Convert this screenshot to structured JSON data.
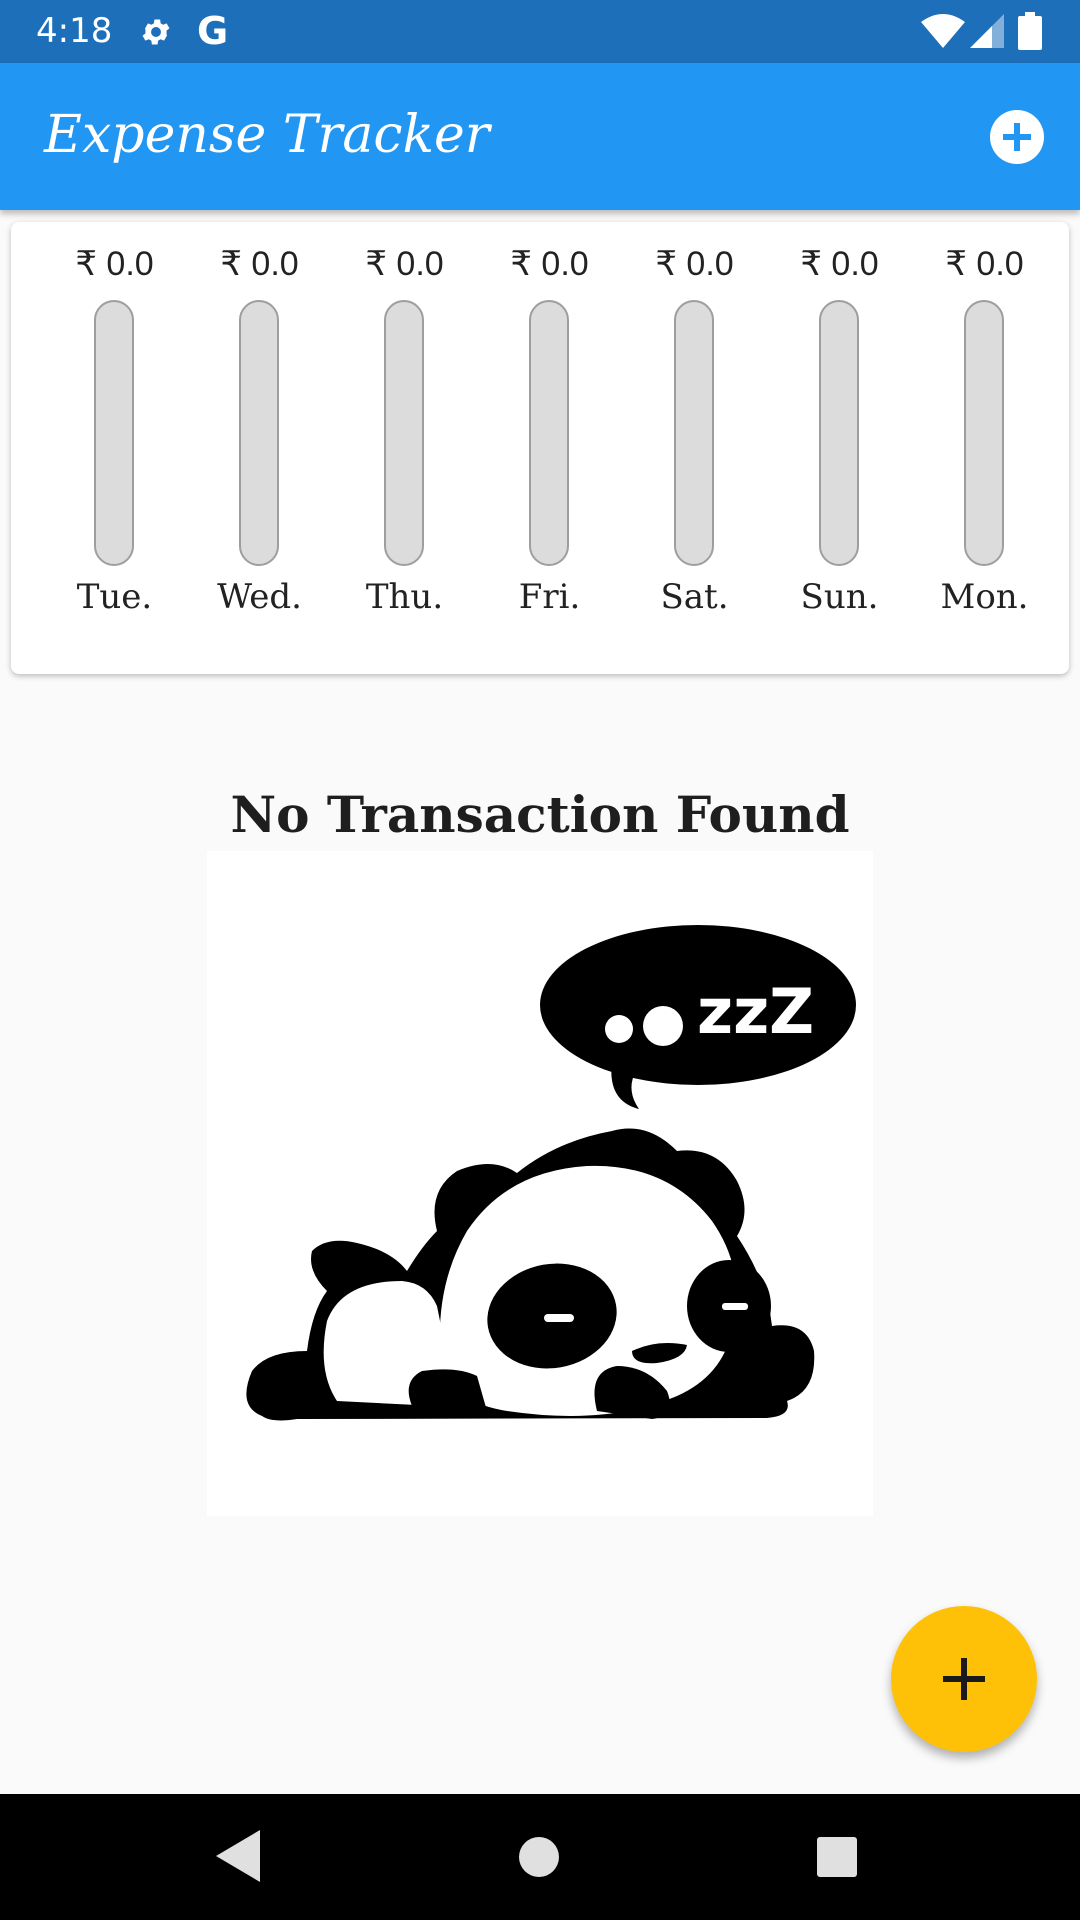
{
  "status_bar": {
    "time": "4:18",
    "left_icons": [
      "gear-icon",
      "google-g-icon"
    ],
    "g_glyph": "G",
    "right_icons": [
      "wifi-icon",
      "signal-icon",
      "battery-icon"
    ]
  },
  "app_bar": {
    "title": "Expense Tracker",
    "action_icon": "add-circle-icon",
    "color": "#2196f3"
  },
  "chart": {
    "bars": [
      {
        "amount": "₹ 0.0",
        "day": "Tue.",
        "fill_fraction": 0
      },
      {
        "amount": "₹ 0.0",
        "day": "Wed.",
        "fill_fraction": 0
      },
      {
        "amount": "₹ 0.0",
        "day": "Thu.",
        "fill_fraction": 0
      },
      {
        "amount": "₹ 0.0",
        "day": "Fri.",
        "fill_fraction": 0
      },
      {
        "amount": "₹ 0.0",
        "day": "Sat.",
        "fill_fraction": 0
      },
      {
        "amount": "₹ 0.0",
        "day": "Sun.",
        "fill_fraction": 0
      },
      {
        "amount": "₹ 0.0",
        "day": "Mon.",
        "fill_fraction": 0
      }
    ]
  },
  "empty_state": {
    "title": "No Transaction Found",
    "image_icon": "sleeping-panda-icon",
    "bubble_text": "zzZ"
  },
  "fab": {
    "icon": "plus-icon",
    "color": "#ffc107"
  },
  "nav_bar": {
    "icons": [
      "back-icon",
      "home-icon",
      "recents-icon"
    ]
  }
}
